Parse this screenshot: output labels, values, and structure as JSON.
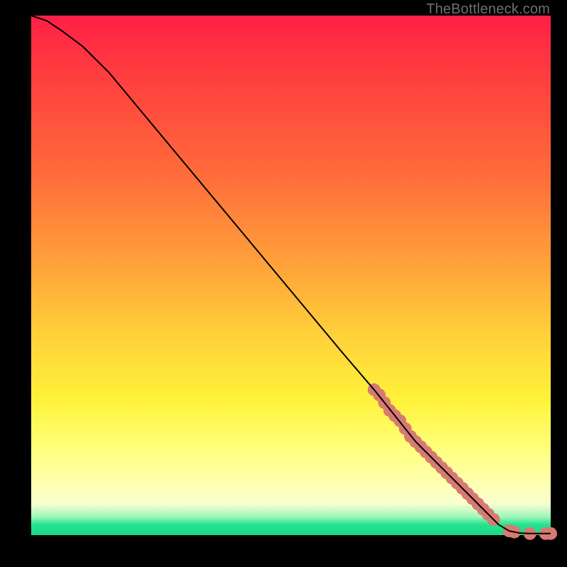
{
  "watermark": "TheBottleneck.com",
  "chart_data": {
    "type": "line",
    "title": "",
    "xlabel": "",
    "ylabel": "",
    "xlim": [
      0,
      100
    ],
    "ylim": [
      0,
      100
    ],
    "grid": false,
    "legend": false,
    "series": [
      {
        "name": "curve",
        "color": "#000000",
        "x": [
          0,
          3,
          6,
          10,
          15,
          20,
          30,
          40,
          50,
          60,
          66,
          70,
          74,
          78,
          82,
          86,
          88,
          90,
          92,
          94,
          96,
          98,
          100
        ],
        "y": [
          100,
          99,
          97,
          94,
          89,
          83,
          71,
          59,
          47,
          35,
          28,
          23,
          18,
          14,
          10,
          6,
          4,
          2,
          0.8,
          0.4,
          0.3,
          0.3,
          0.3
        ]
      }
    ],
    "markers": {
      "name": "highlighted-points",
      "color": "#d77a72",
      "radius_px": 9,
      "x": [
        66,
        67,
        68,
        69,
        70,
        71,
        72,
        73,
        74,
        75,
        76,
        77,
        78,
        79,
        80,
        81,
        82,
        83,
        84,
        85,
        86,
        87,
        88,
        89,
        92,
        93,
        96,
        99,
        100
      ],
      "y": [
        28,
        27,
        25.5,
        24,
        23,
        22,
        20.5,
        19,
        18,
        17,
        16,
        15,
        14,
        13,
        12,
        11,
        10,
        9,
        8,
        7,
        6,
        5,
        4,
        3,
        0.8,
        0.6,
        0.3,
        0.3,
        0.3
      ]
    }
  }
}
